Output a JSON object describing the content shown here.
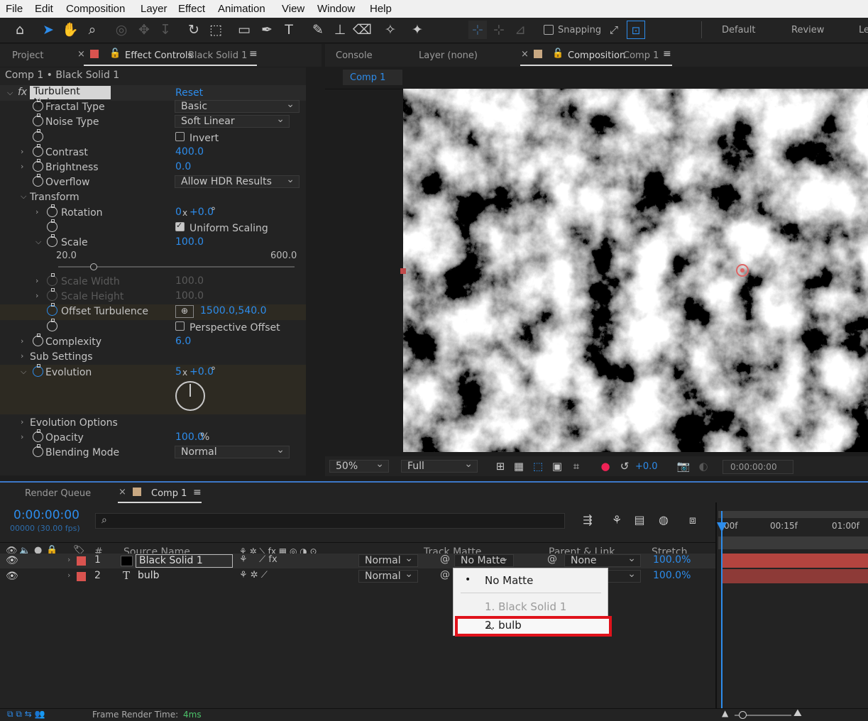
{
  "menubar": [
    "File",
    "Edit",
    "Composition",
    "Layer",
    "Effect",
    "Animation",
    "View",
    "Window",
    "Help"
  ],
  "toolbar": {
    "snapping_label": "Snapping",
    "workspaces": [
      "Default",
      "Review",
      "Le"
    ]
  },
  "left_panel": {
    "tab_project": "Project",
    "tab_effect_controls": "Effect Controls",
    "tab_effect_target": "Black Solid 1",
    "breadcrumb": "Comp 1 • Black Solid 1",
    "effect": {
      "fx": "fx",
      "name": "Turbulent Noise",
      "reset": "Reset"
    },
    "props": {
      "fractal_type": {
        "label": "Fractal Type",
        "value": "Basic"
      },
      "noise_type": {
        "label": "Noise Type",
        "value": "Soft Linear"
      },
      "invert": {
        "label": "Invert"
      },
      "contrast": {
        "label": "Contrast",
        "value": "400.0"
      },
      "brightness": {
        "label": "Brightness",
        "value": "0.0"
      },
      "overflow": {
        "label": "Overflow",
        "value": "Allow HDR Results"
      },
      "transform": {
        "label": "Transform"
      },
      "rotation": {
        "label": "Rotation",
        "rev": "0",
        "x": "x",
        "deg": "+0.0",
        "unit": "°"
      },
      "uniform_scaling": {
        "label": "Uniform Scaling"
      },
      "scale": {
        "label": "Scale",
        "value": "100.0",
        "min": "20.0",
        "max": "600.0",
        "slider_fraction": 0.15
      },
      "scale_width": {
        "label": "Scale Width",
        "value": "100.0"
      },
      "scale_height": {
        "label": "Scale Height",
        "value": "100.0"
      },
      "offset_turbulence": {
        "label": "Offset Turbulence",
        "value": "1500.0,540.0"
      },
      "perspective_offset": {
        "label": "Perspective Offset"
      },
      "complexity": {
        "label": "Complexity",
        "value": "6.0"
      },
      "sub_settings": {
        "label": "Sub Settings"
      },
      "evolution": {
        "label": "Evolution",
        "rev": "5",
        "x": "x",
        "deg": "+0.0",
        "unit": "°"
      },
      "evolution_options": {
        "label": "Evolution Options"
      },
      "opacity": {
        "label": "Opacity",
        "value": "100.0",
        "unit": "%"
      },
      "blending_mode": {
        "label": "Blending Mode",
        "value": "Normal"
      }
    }
  },
  "right_panel": {
    "tab_console": "Console",
    "tab_layer": "Layer (none)",
    "tab_composition": "Composition",
    "tab_comp_name": "Comp 1",
    "comp_subtab": "Comp 1",
    "footer": {
      "zoom": "50%",
      "resolution": "Full",
      "exposure": "+0.0",
      "timecode": "0:00:00:00"
    }
  },
  "timeline": {
    "tab_render_queue": "Render Queue",
    "tab_comp": "Comp 1",
    "timecode": "0:00:00:00",
    "frames": "00000 (30.00 fps)",
    "search_icon": "⌕",
    "columns": {
      "num": "#",
      "source_name": "Source Name",
      "track_matte": "Track Matte",
      "parent_link": "Parent & Link",
      "stretch": "Stretch"
    },
    "ruler": [
      "00f",
      "00:15f",
      "01:00f"
    ],
    "layers": [
      {
        "num": "1",
        "name": "Black Solid 1",
        "mode": "Normal",
        "matte": "No Matte",
        "parent": "None",
        "stretch": "100.0%",
        "color": "#d9534f"
      },
      {
        "num": "2",
        "type_icon": "T",
        "name": "bulb",
        "mode": "Normal",
        "stretch": "100.0%",
        "color": "#d9534f"
      }
    ],
    "status": {
      "label": "Frame Render Time:",
      "value": "4ms"
    }
  },
  "matte_menu": {
    "bullet": "•",
    "items": [
      "No Matte",
      "1. Black Solid 1",
      "2. bulb"
    ],
    "highlight_color": "#e0121b"
  }
}
